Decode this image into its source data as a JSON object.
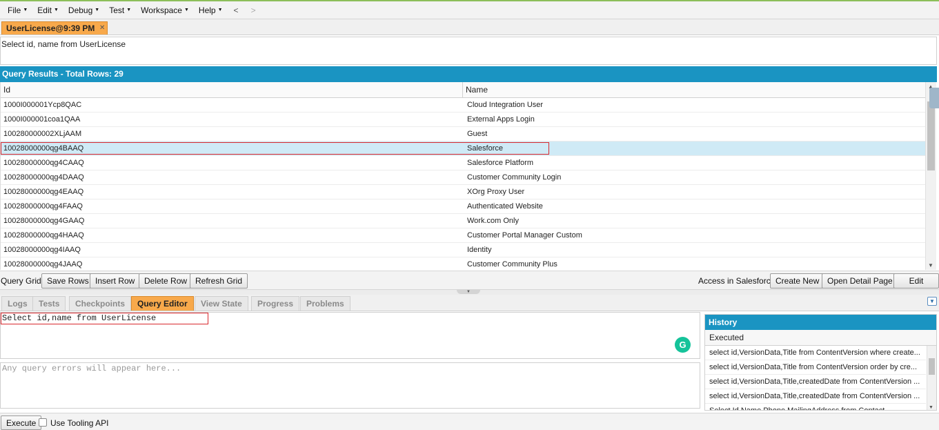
{
  "menu": {
    "items": [
      "File",
      "Edit",
      "Debug",
      "Test",
      "Workspace",
      "Help"
    ],
    "back": "<",
    "forward": ">"
  },
  "file_tab": {
    "label": "UserLicense@9:39 PM",
    "close": "✕"
  },
  "query_text": "Select id, name from UserLicense",
  "results": {
    "header": "Query Results - Total Rows: 29",
    "columns": [
      "Id",
      "Name"
    ],
    "rows": [
      {
        "id": "1000I000001Ycp8QAC",
        "name": "Cloud Integration User"
      },
      {
        "id": "1000I000001coa1QAA",
        "name": "External Apps Login"
      },
      {
        "id": "100280000002XLjAAM",
        "name": "Guest"
      },
      {
        "id": "10028000000qg4BAAQ",
        "name": "Salesforce"
      },
      {
        "id": "10028000000qg4CAAQ",
        "name": "Salesforce Platform"
      },
      {
        "id": "10028000000qg4DAAQ",
        "name": "Customer Community Login"
      },
      {
        "id": "10028000000qg4EAAQ",
        "name": "XOrg Proxy User"
      },
      {
        "id": "10028000000qg4FAAQ",
        "name": "Authenticated Website"
      },
      {
        "id": "10028000000qg4GAAQ",
        "name": "Work.com Only"
      },
      {
        "id": "10028000000qg4HAAQ",
        "name": "Customer Portal Manager Custom"
      },
      {
        "id": "10028000000qg4IAAQ",
        "name": "Identity"
      },
      {
        "id": "10028000000qg4JAAQ",
        "name": "Customer Community Plus"
      }
    ],
    "selected_row_index": 3
  },
  "grid_toolbar": {
    "label": "Query Grid:",
    "save_rows": "Save Rows",
    "insert_row": "Insert Row",
    "delete_row": "Delete Row",
    "refresh_grid": "Refresh Grid",
    "access_label": "Access in Salesforce:",
    "create_new": "Create New",
    "open_detail": "Open Detail Page",
    "edit_page": "Edit Page"
  },
  "bottom_tabs": [
    "Logs",
    "Tests",
    "Checkpoints",
    "Query Editor",
    "View State",
    "Progress",
    "Problems"
  ],
  "active_bottom_tab": "Query Editor",
  "editor": {
    "query": "Select id,name from UserLicense",
    "errors_placeholder": "Any query errors will appear here...",
    "grammarly_icon": "G"
  },
  "history": {
    "title": "History",
    "column": "Executed",
    "rows": [
      "select id,VersionData,Title from ContentVersion where create...",
      "select id,VersionData,Title from ContentVersion order by cre...",
      "select id,VersionData,Title,createdDate from ContentVersion ...",
      "select id,VersionData,Title,createdDate from ContentVersion ...",
      "Select Id,Name,Phone,MailingAddress from Contact"
    ]
  },
  "bottom_bar": {
    "execute": "Execute",
    "tooling_label": "Use Tooling API"
  },
  "colors": {
    "accent_blue": "#1a94c2",
    "active_tab_orange": "#f8a94b",
    "selected_row": "#cfeaf6",
    "highlight_red": "#d9262b"
  }
}
